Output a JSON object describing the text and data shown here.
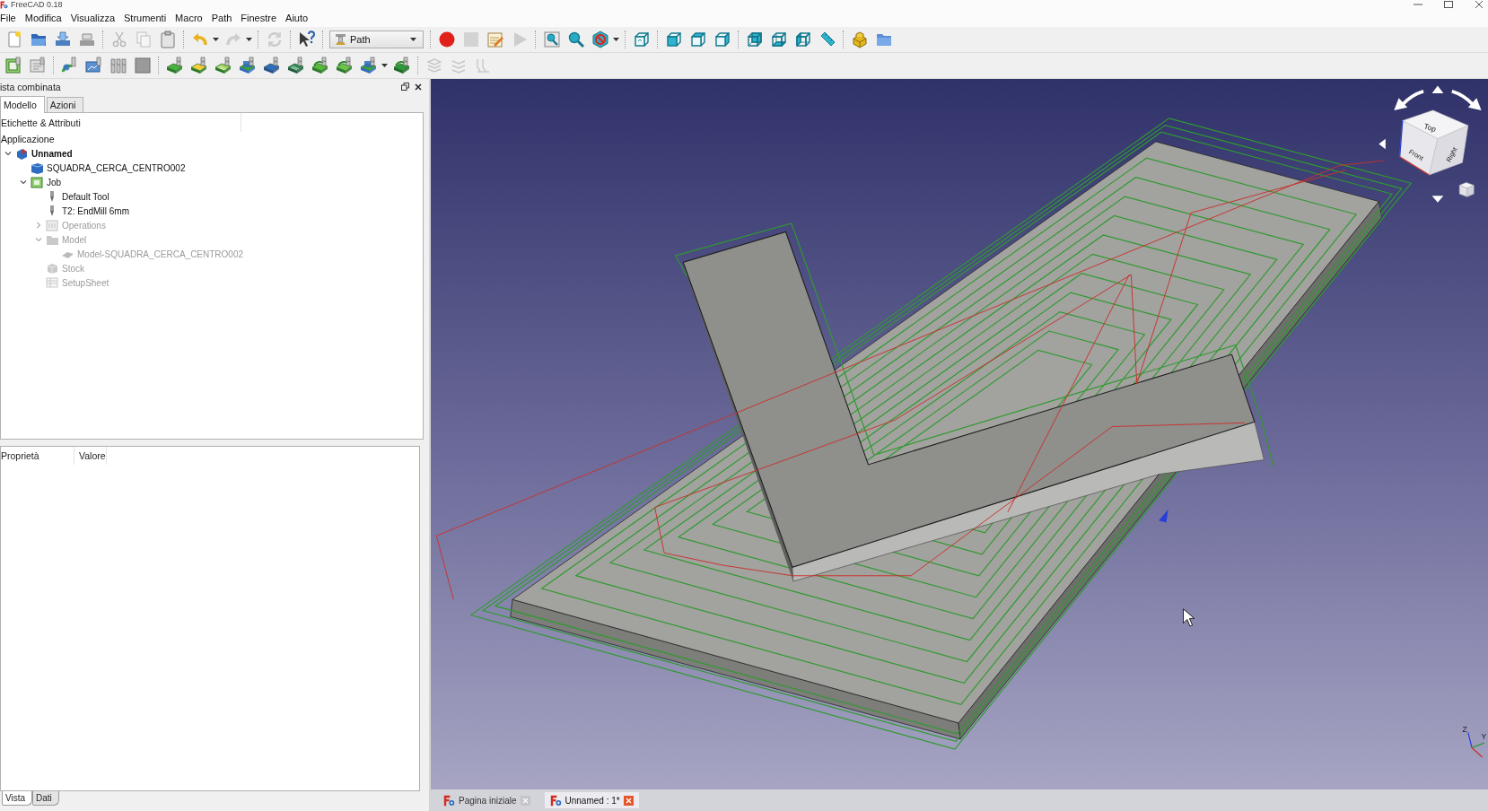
{
  "window": {
    "title": "FreeCAD 0.18"
  },
  "menu": [
    "File",
    "Modifica",
    "Visualizza",
    "Strumenti",
    "Macro",
    "Path",
    "Finestre",
    "Aiuto"
  ],
  "toolbar_rows": [
    {
      "groups": [
        [
          {
            "kind": "new",
            "disabled": false
          },
          {
            "kind": "open",
            "disabled": false
          },
          {
            "kind": "save",
            "disabled": false
          },
          {
            "kind": "save_as",
            "disabled": false
          }
        ],
        [
          {
            "kind": "cut",
            "disabled": true
          },
          {
            "kind": "copy",
            "disabled": true
          },
          {
            "kind": "paste",
            "disabled": false
          }
        ],
        [
          {
            "kind": "undo",
            "disabled": false
          },
          {
            "kind": "redo",
            "disabled": true
          }
        ],
        [
          {
            "kind": "refresh",
            "disabled": true
          }
        ],
        [
          {
            "kind": "whats_this",
            "disabled": false
          }
        ],
        [
          {
            "kind": "workbench_selector",
            "label": "Path",
            "disabled": false
          }
        ],
        [
          {
            "kind": "macro_record",
            "disabled": false
          },
          {
            "kind": "macro_stop",
            "disabled": true
          },
          {
            "kind": "macro_edit",
            "disabled": false
          },
          {
            "kind": "macro_run",
            "disabled": true
          }
        ],
        [
          {
            "kind": "fit_all",
            "disabled": false
          },
          {
            "kind": "fit_selection",
            "disabled": false
          },
          {
            "kind": "draw_style",
            "disabled": false
          }
        ],
        [
          {
            "kind": "view_iso",
            "disabled": false
          }
        ],
        [
          {
            "kind": "view_front",
            "disabled": false
          },
          {
            "kind": "view_top",
            "disabled": false
          },
          {
            "kind": "view_right",
            "disabled": false
          }
        ],
        [
          {
            "kind": "view_rear",
            "disabled": false
          },
          {
            "kind": "view_bottom",
            "disabled": false
          },
          {
            "kind": "view_left",
            "disabled": false
          },
          {
            "kind": "measure",
            "disabled": false
          }
        ],
        [
          {
            "kind": "part",
            "disabled": false
          },
          {
            "kind": "group",
            "disabled": false
          }
        ]
      ]
    },
    {
      "groups": [
        [
          {
            "kind": "job",
            "disabled": false
          },
          {
            "kind": "post_process",
            "disabled": false
          }
        ],
        [
          {
            "kind": "inspect",
            "disabled": false
          },
          {
            "kind": "simulator",
            "disabled": false
          },
          {
            "kind": "tool_library",
            "disabled": false
          },
          {
            "kind": "sanity_check",
            "disabled": false
          }
        ],
        [
          {
            "kind": "contour",
            "disabled": false
          },
          {
            "kind": "profile_faces",
            "disabled": false
          },
          {
            "kind": "profile_edges",
            "disabled": false
          },
          {
            "kind": "pocket",
            "disabled": false
          },
          {
            "kind": "drilling",
            "disabled": false
          },
          {
            "kind": "face_mill",
            "disabled": false
          },
          {
            "kind": "helix",
            "disabled": false
          },
          {
            "kind": "engrave",
            "disabled": false
          },
          {
            "kind": "pocket_3d",
            "disabled": false
          },
          {
            "kind": "surface",
            "disabled": false
          }
        ],
        [
          {
            "kind": "copy_op",
            "disabled": true
          },
          {
            "kind": "array_op",
            "disabled": true
          },
          {
            "kind": "stop_op",
            "disabled": true
          }
        ]
      ]
    }
  ],
  "combo_view": {
    "title": "ista combinata",
    "tabs": [
      {
        "label": "Modello",
        "selected": true
      },
      {
        "label": "Azioni",
        "selected": false
      }
    ],
    "tree_header": "Etichette & Attributi",
    "tree_root": "Applicazione",
    "tree": [
      {
        "label": "Unnamed",
        "kind": "document",
        "expanded": true,
        "visible": true,
        "children": [
          {
            "label": "SQUADRA_CERCA_CENTRO002",
            "kind": "body",
            "visible": true
          },
          {
            "label": "Job",
            "kind": "job",
            "expanded": true,
            "visible": true,
            "children": [
              {
                "label": "Default Tool",
                "kind": "tool",
                "visible": true
              },
              {
                "label": "T2: EndMill 6mm",
                "kind": "tool",
                "visible": true
              },
              {
                "label": "Operations",
                "kind": "operations",
                "expanded": false,
                "visible": false
              },
              {
                "label": "Model",
                "kind": "folder",
                "expanded": true,
                "visible": false,
                "children": [
                  {
                    "label": "Model-SQUADRA_CERCA_CENTRO002",
                    "kind": "clone",
                    "visible": false
                  }
                ]
              },
              {
                "label": "Stock",
                "kind": "stock",
                "visible": false
              },
              {
                "label": "SetupSheet",
                "kind": "sheet",
                "visible": false
              }
            ]
          }
        ]
      }
    ]
  },
  "property_view": {
    "columns": [
      "Proprietà",
      "Valore"
    ],
    "tabs": [
      {
        "label": "Vista",
        "selected": true
      },
      {
        "label": "Dati",
        "selected": false
      }
    ]
  },
  "navigation_cube": {
    "faces": [
      "Top",
      "Front",
      "Right"
    ]
  },
  "axis_labels": [
    "Z",
    "Y"
  ],
  "view_tabs": [
    {
      "label": "Pagina iniziale",
      "selected": false
    },
    {
      "label": "Unnamed : 1*",
      "selected": true
    }
  ]
}
